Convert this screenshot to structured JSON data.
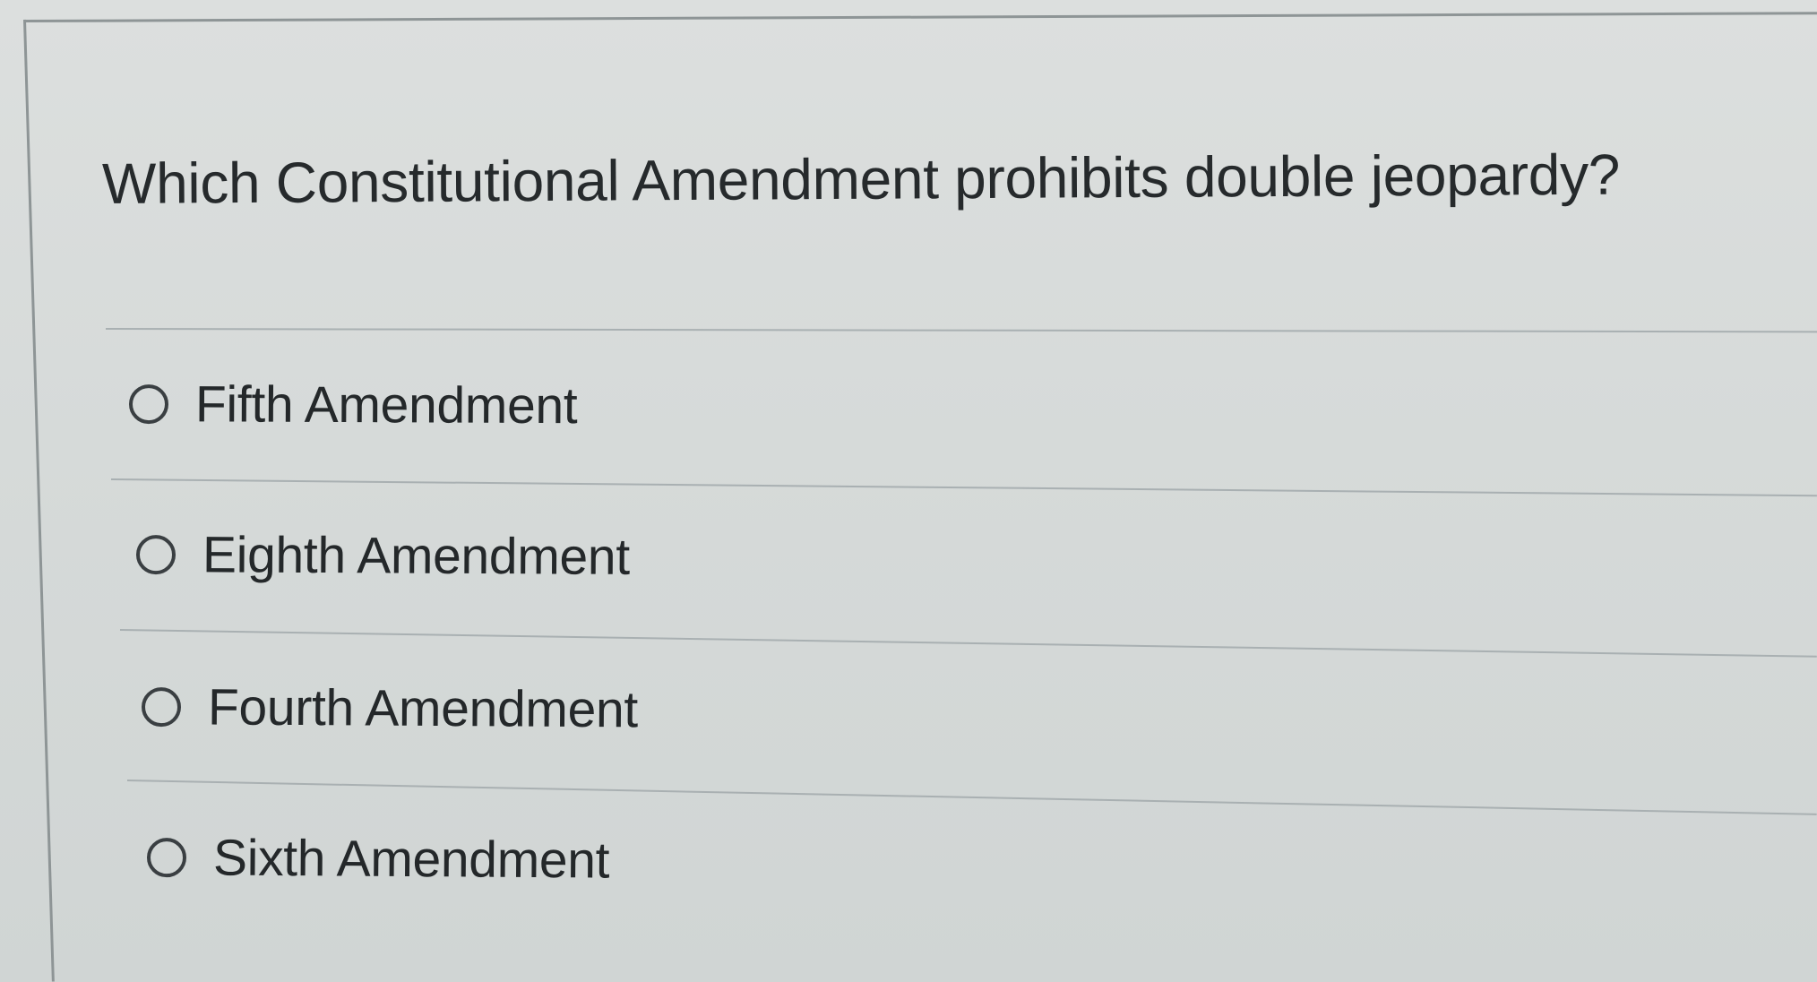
{
  "quiz": {
    "question": "Which Constitutional Amendment prohibits double jeopardy?",
    "options": [
      {
        "label": "Fifth Amendment",
        "selected": false
      },
      {
        "label": "Eighth Amendment",
        "selected": false
      },
      {
        "label": "Fourth Amendment",
        "selected": false
      },
      {
        "label": "Sixth Amendment",
        "selected": false
      }
    ]
  },
  "colors": {
    "background": "#d6dad9",
    "text": "#262a2c",
    "divider": "#a9b0b2",
    "radio_border": "#3a3f42"
  },
  "icons": {
    "radio": "radio-unselected-icon"
  }
}
